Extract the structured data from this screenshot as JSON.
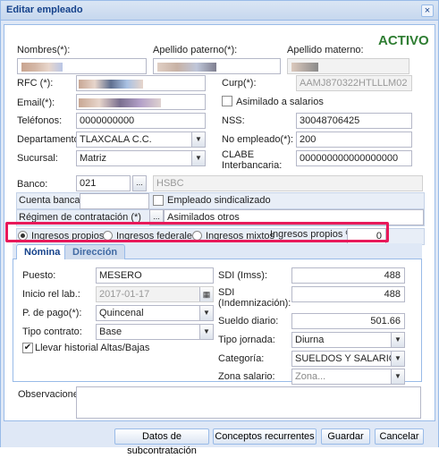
{
  "window": {
    "title": "Editar empleado",
    "close": "×"
  },
  "status": {
    "text": "ACTIVO",
    "color": "#2e7d32"
  },
  "labels": {
    "nombres": "Nombres(*):",
    "apellido_paterno": "Apellido paterno(*):",
    "apellido_materno": "Apellido materno:",
    "rfc": "RFC (*):",
    "curp": "Curp(*):",
    "email": "Email(*):",
    "asimilado": "Asimilado a salarios",
    "telefonos": "Teléfonos:",
    "nss": "NSS:",
    "departamento": "Departamento:",
    "no_empleado": "No empleado(*):",
    "sucursal": "Sucursal:",
    "clabe": "CLABE",
    "clabe2": "Interbancaria:",
    "banco": "Banco:",
    "cuenta": "Cuenta bancaria",
    "sindicalizado": "Empleado sindicalizado",
    "regimen": "Régimen de contratación (*)",
    "ingresos_pct": "Ingresos propios %",
    "observaciones": "Observaciones"
  },
  "values": {
    "curp": "AAMJ870322HTLLLM02",
    "telefonos": "0000000000",
    "nss": "30048706425",
    "departamento": "TLAXCALA C.C.",
    "no_empleado": "200",
    "sucursal": "Matriz",
    "clabe": "000000000000000000",
    "banco_code": "021",
    "banco_ellipsis": "...",
    "banco_name": "HSBC",
    "regimen_ellipsis": "...",
    "regimen": "Asimilados otros",
    "ingresos_pct": "0"
  },
  "income": {
    "options": [
      "Ingresos propios",
      "Ingresos federales",
      "Ingresos mixtos"
    ],
    "selected": 0
  },
  "tabs": {
    "nomina": "Nómina",
    "direccion": "Dirección"
  },
  "nomina": {
    "puesto_label": "Puesto:",
    "puesto": "MESERO",
    "inicio_label": "Inicio rel lab.:",
    "inicio": "2017-01-17",
    "pago_label": "P. de pago(*):",
    "pago": "Quincenal",
    "tipo_contrato_label": "Tipo contrato:",
    "tipo_contrato": "Base",
    "historial_label": "Llevar historial Altas/Bajas",
    "sdi_imss_label": "SDI (Imss):",
    "sdi_imss": "488",
    "sdi_ind_label1": "SDI",
    "sdi_ind_label2": "(Indemnización):",
    "sdi_ind": "488",
    "sueldo_label": "Sueldo diario:",
    "sueldo": "501.66",
    "jornada_label": "Tipo jornada:",
    "jornada": "Diurna",
    "categoria_label": "Categoría:",
    "categoria": "SUELDOS Y SALARIOS",
    "zona_label": "Zona salario:",
    "zona_placeholder": "Zona..."
  },
  "buttons": {
    "subcontratacion": "Datos de subcontratación",
    "conceptos": "Conceptos recurrentes",
    "guardar": "Guardar",
    "cancelar": "Cancelar"
  },
  "icons": {
    "dropdown": "▼",
    "calendar": "calendar-icon",
    "check": "✔"
  }
}
